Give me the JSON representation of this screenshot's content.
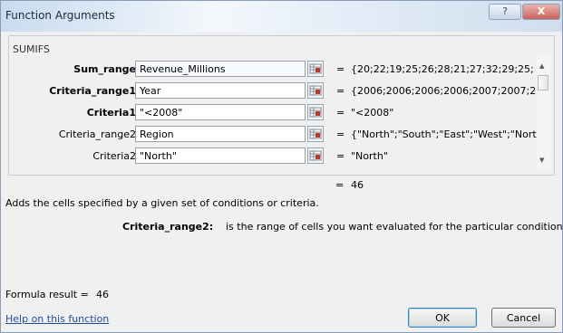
{
  "window": {
    "title": "Function Arguments",
    "help_glyph": "?",
    "close_glyph": "X"
  },
  "function_name": "SUMIFS",
  "arguments": [
    {
      "label": "Sum_range",
      "bold": true,
      "value": "Revenue_Millions",
      "result": "{20;22;19;25;26;28;21;27;32;29;25;"
    },
    {
      "label": "Criteria_range1",
      "bold": true,
      "value": "Year",
      "result": "{2006;2006;2006;2006;2007;2007;2("
    },
    {
      "label": "Criteria1",
      "bold": true,
      "value": "\"<2008\"",
      "result": "\"<2008\""
    },
    {
      "label": "Criteria_range2",
      "bold": false,
      "value": "Region",
      "result": "{\"North\";\"South\";\"East\";\"West\";\"Nortl"
    },
    {
      "label": "Criteria2",
      "bold": false,
      "value": "\"North\"",
      "result": "\"North\""
    }
  ],
  "equals": "=",
  "overall_result": "46",
  "description": "Adds the cells specified by a given set of conditions or criteria.",
  "arg_help": {
    "name": "Criteria_range2:",
    "text": "is the range of cells you want evaluated for the particular condition."
  },
  "formula_result": {
    "label": "Formula result =",
    "value": "46"
  },
  "help_link": "Help on this function",
  "buttons": {
    "ok": "OK",
    "cancel": "Cancel"
  },
  "icons": {
    "ref_button": "collapse-dialog-icon",
    "scroll_up": "▲",
    "scroll_down": "▼"
  }
}
